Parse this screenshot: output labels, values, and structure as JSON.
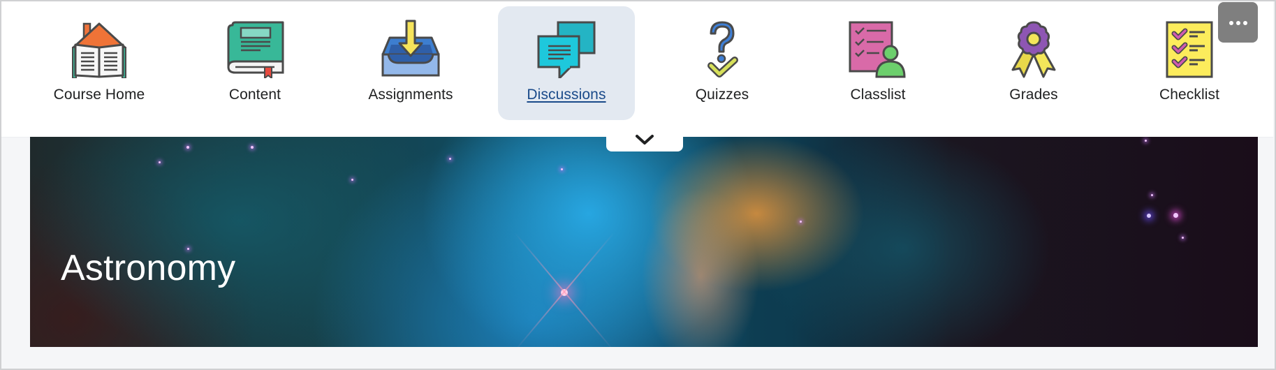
{
  "nav": {
    "items": [
      {
        "label": "Course Home",
        "icon": "course-home-icon",
        "active": false
      },
      {
        "label": "Content",
        "icon": "content-book-icon",
        "active": false
      },
      {
        "label": "Assignments",
        "icon": "assignments-inbox-icon",
        "active": false
      },
      {
        "label": "Discussions",
        "icon": "discussions-chat-icon",
        "active": true
      },
      {
        "label": "Quizzes",
        "icon": "quizzes-question-icon",
        "active": false
      },
      {
        "label": "Classlist",
        "icon": "classlist-icon",
        "active": false
      },
      {
        "label": "Grades",
        "icon": "grades-ribbon-icon",
        "active": false
      },
      {
        "label": "Checklist",
        "icon": "checklist-icon",
        "active": false
      }
    ],
    "more_button": {
      "icon": "more-ellipsis-icon",
      "label": "More"
    },
    "expand_button": {
      "icon": "chevron-down-icon"
    }
  },
  "banner": {
    "title": "Astronomy",
    "image": "nebula-banner-image"
  },
  "colors": {
    "active_bg": "#e3e9f1",
    "active_text": "#1a4a8a",
    "text": "#202122",
    "more_button_bg": "#7f7f7f",
    "page_bg": "#f5f6f8"
  }
}
